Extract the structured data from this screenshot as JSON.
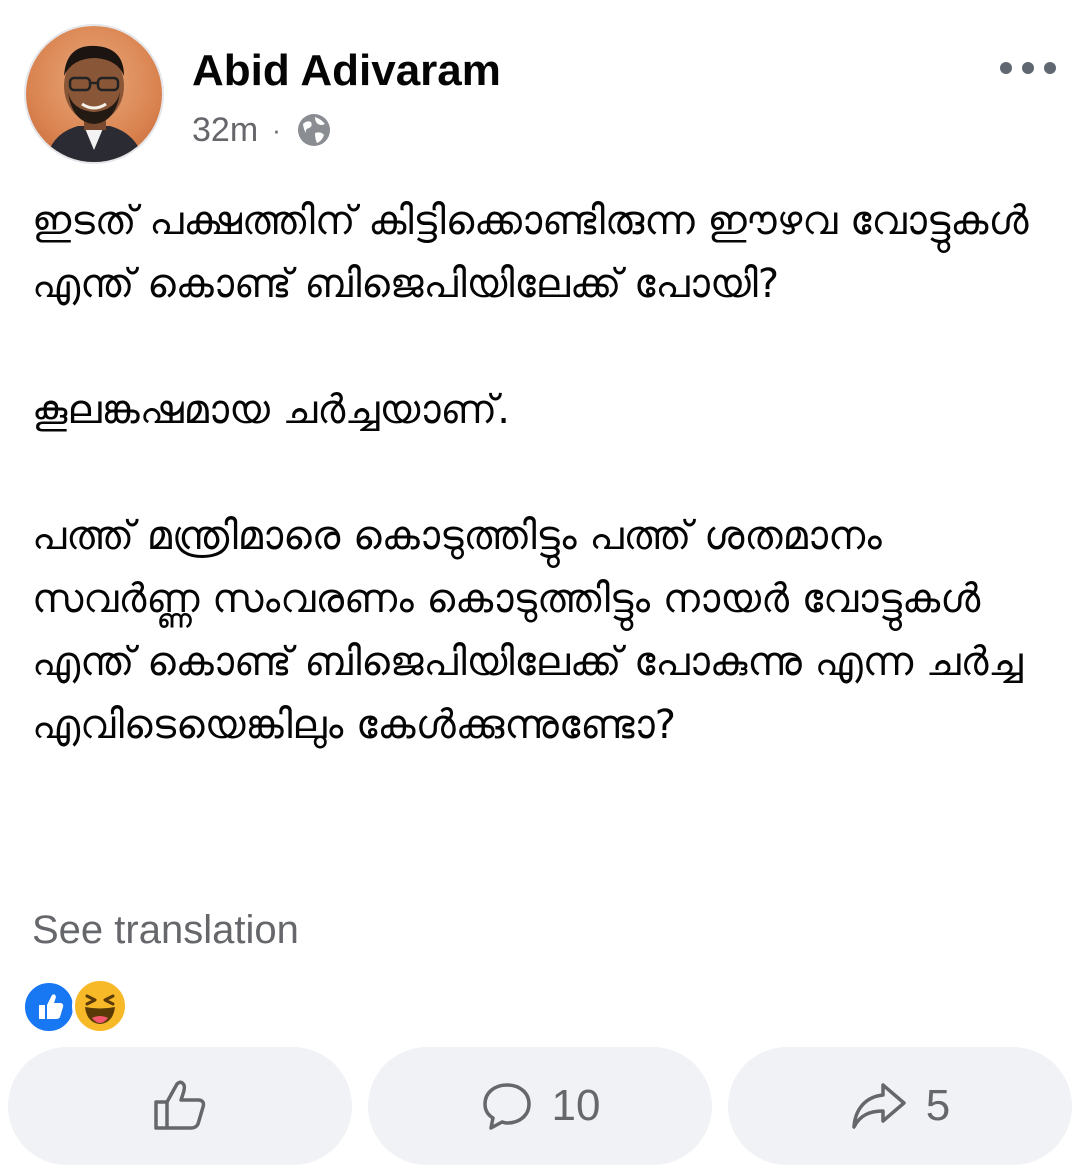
{
  "post": {
    "author": "Abid Adivaram",
    "timestamp": "32m",
    "separator": "·",
    "privacy_icon": "globe-icon",
    "paragraphs": [
      "ഇടത് പക്ഷത്തിന് കിട്ടിക്കൊണ്ടിരുന്ന ഈഴവ വോട്ടുകൾ എന്ത് കൊണ്ട് ബിജെപിയിലേക്ക് പോയി?",
      "കൂലങ്കഷമായ ചർച്ചയാണ്.",
      "പത്ത് മന്ത്രിമാരെ കൊടുത്തിട്ടും പത്ത് ശതമാനം സവർണ്ണ സംവരണം കൊടുത്തിട്ടും നായർ വോട്ടുകൾ എന്ത് കൊണ്ട് ബിജെപിയിലേക്ക് പോകുന്നു എന്ന ചർച്ച എവിടെയെങ്കിലും കേൾക്കുന്നുണ്ടോ?"
    ],
    "see_translation": "See translation",
    "reactions": [
      "like-reaction-icon",
      "haha-reaction-icon"
    ]
  },
  "actions": {
    "like": {
      "icon": "thumbs-up-icon"
    },
    "comment": {
      "icon": "comment-icon",
      "count": "10"
    },
    "share": {
      "icon": "share-icon",
      "count": "5"
    }
  },
  "colors": {
    "text": "#050505",
    "secondary": "#65676b",
    "button_bg": "#f0f2f5",
    "like_blue": "#1877f2",
    "haha_yellow": "#f7b928"
  }
}
